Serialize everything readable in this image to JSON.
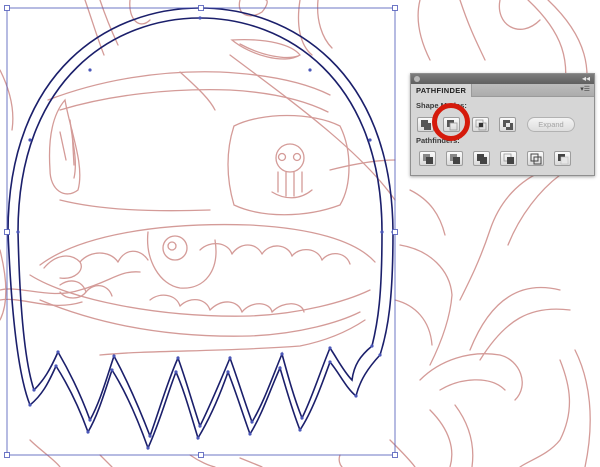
{
  "panel": {
    "title": "PATHFINDER",
    "collapse_icon": "double-chevron-icon",
    "menu_icon": "panel-menu-icon",
    "shape_modes_label": "Shape Modes:",
    "pathfinders_label": "Pathfinders:",
    "expand_label": "Expand",
    "shape_mode_buttons": [
      "unite-icon",
      "minus-front-icon",
      "intersect-icon",
      "exclude-icon"
    ],
    "pathfinder_buttons": [
      "divide-icon",
      "trim-icon",
      "merge-icon",
      "crop-icon",
      "outline-icon",
      "minus-back-icon"
    ]
  },
  "highlight": {
    "target": "minus-front-button",
    "color": "#d51a0b"
  },
  "colors": {
    "sketch": "#d49b98",
    "path": "#1b1f6b",
    "selection": "#4a56b8"
  }
}
